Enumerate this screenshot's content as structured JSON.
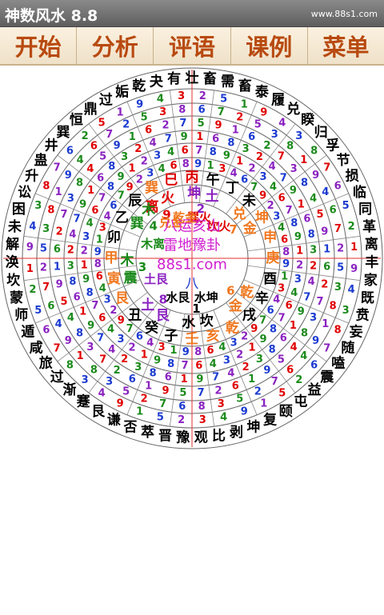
{
  "app": {
    "title": "神数风水 8.8",
    "site": "www.88s1.com"
  },
  "menu": [
    {
      "label": "开始"
    },
    {
      "label": "分析"
    },
    {
      "label": "评语"
    },
    {
      "label": "课例"
    },
    {
      "label": "菜单"
    }
  ],
  "colors": {
    "menu_text": "#b84a10",
    "red": "#e00000",
    "orange": "#f07820",
    "green": "#1a8a1a",
    "purple": "#8a22c0",
    "blue": "#1a3ad0",
    "magenta": "#d020d0",
    "black": "#000000"
  },
  "compass": {
    "center_lines": [
      "八运亥山",
      "雷地豫卦",
      "88s1.com"
    ],
    "center_bottom": "八",
    "trigrams": [
      {
        "angle": -30,
        "name": "离",
        "elem": "火",
        "num": "9",
        "color": "red"
      },
      {
        "angle": 10,
        "name": "坤",
        "elem": "土",
        "num": "2",
        "color": "purple"
      },
      {
        "angle": 55,
        "name": "兑",
        "elem": "金",
        "num": "7",
        "color": "orange"
      },
      {
        "angle": 130,
        "name": "乾",
        "elem": "金",
        "num": "6",
        "color": "orange"
      },
      {
        "angle": 175,
        "name": "坎",
        "elem": "水",
        "num": "1",
        "color": "black"
      },
      {
        "angle": 215,
        "name": "艮",
        "elem": "土",
        "num": "8",
        "color": "purple"
      },
      {
        "angle": 260,
        "name": "震",
        "elem": "木",
        "num": "3",
        "color": "green"
      },
      {
        "angle": 310,
        "name": "巽",
        "elem": "木",
        "num": "4",
        "color": "green"
      }
    ],
    "inner_stars": [
      {
        "angle": 10,
        "text": "巽火",
        "color": "red"
      },
      {
        "angle": 40,
        "text": "坎火",
        "color": "red"
      },
      {
        "angle": 160,
        "text": "水坤",
        "color": "black"
      },
      {
        "angle": 200,
        "text": "水艮",
        "color": "black"
      },
      {
        "angle": 240,
        "text": "土艮",
        "color": "purple"
      },
      {
        "angle": 290,
        "text": "木离",
        "color": "green"
      },
      {
        "angle": 330,
        "text": "兑金",
        "color": "orange"
      },
      {
        "angle": 350,
        "text": "乾金",
        "color": "orange"
      }
    ],
    "mountains": [
      "壬",
      "子",
      "癸",
      "丑",
      "艮",
      "寅",
      "甲",
      "卯",
      "乙",
      "辰",
      "巽",
      "巳",
      "丙",
      "午",
      "丁",
      "未",
      "坤",
      "申",
      "庚",
      "酉",
      "辛",
      "戌",
      "乾",
      "亥"
    ],
    "mountain_colors": [
      "orange",
      "black",
      "black",
      "black",
      "orange",
      "orange",
      "orange",
      "black",
      "black",
      "black",
      "orange",
      "red",
      "red",
      "black",
      "black",
      "black",
      "orange",
      "orange",
      "orange",
      "black",
      "black",
      "black",
      "orange",
      "orange"
    ],
    "ring1_digits": [
      "2",
      "5",
      "1",
      "9",
      "4",
      "3",
      "8",
      "7",
      "6",
      "5",
      "2",
      "1",
      "9",
      "4",
      "3",
      "8",
      "7",
      "6",
      "2",
      "5",
      "1",
      "9",
      "4",
      "3"
    ],
    "ring2_digits": [
      "6",
      "7",
      "2",
      "5",
      "3",
      "8",
      "1",
      "9",
      "4",
      "6",
      "7",
      "2",
      "5",
      "3",
      "8",
      "1",
      "9",
      "4",
      "6",
      "7",
      "2",
      "5",
      "3",
      "8"
    ],
    "ring3_digits": [
      "5",
      "9",
      "1",
      "6",
      "2",
      "7",
      "3",
      "8",
      "4",
      "5",
      "9",
      "1",
      "6",
      "2",
      "7",
      "3",
      "8",
      "4",
      "5",
      "9",
      "1",
      "6",
      "2",
      "7"
    ],
    "ring4_digits": [
      "1",
      "6",
      "8",
      "3",
      "2",
      "4",
      "7",
      "9",
      "1",
      "6",
      "8",
      "3",
      "2",
      "4",
      "7",
      "9",
      "1",
      "6",
      "8",
      "3",
      "2",
      "4",
      "7",
      "9"
    ],
    "ring5_digits": [
      "7",
      "8",
      "9",
      "1",
      "2",
      "3",
      "4",
      "6",
      "7",
      "8",
      "9",
      "1",
      "2",
      "3",
      "4",
      "6",
      "7",
      "8",
      "9",
      "1",
      "2",
      "3",
      "4",
      "6"
    ],
    "ring6_digits": [
      "9",
      "1",
      "3",
      "4",
      "6",
      "7",
      "9",
      "2",
      "3",
      "4",
      "6",
      "8",
      "9",
      "1",
      "3",
      "4",
      "6",
      "7",
      "9",
      "2",
      "3",
      "4",
      "6",
      "8"
    ],
    "ring7_digits": [
      "2",
      "8",
      "4",
      "6",
      "9",
      "1",
      "3",
      "7",
      "2",
      "8",
      "4",
      "6",
      "9",
      "1",
      "3",
      "7",
      "2",
      "8",
      "4",
      "6",
      "9",
      "1",
      "3",
      "7"
    ],
    "hexagrams": [
      "豫",
      "晋",
      "萃",
      "否",
      "谦",
      "艮",
      "蹇",
      "渐",
      "过",
      "旅",
      "咸",
      "遁",
      "师",
      "蒙",
      "坎",
      "涣",
      "解",
      "未",
      "困",
      "讼",
      "升",
      "蛊",
      "井",
      "巽",
      "恒",
      "鼎",
      "过",
      "姤",
      "乾",
      "夬",
      "有",
      "壮",
      "畜",
      "需",
      "畜",
      "泰",
      "履",
      "兑",
      "睽",
      "归",
      "孚",
      "节",
      "损",
      "临",
      "同",
      "革",
      "离",
      "丰",
      "家",
      "既",
      "贲",
      "妄",
      "随",
      "嗑",
      "震",
      "益",
      "屯",
      "颐",
      "复",
      "坤",
      "剥",
      "比",
      "观"
    ]
  }
}
